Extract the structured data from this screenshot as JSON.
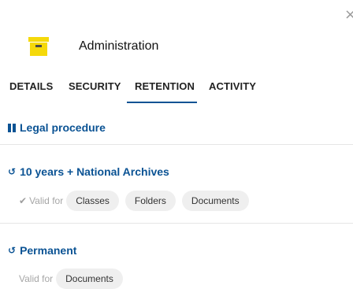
{
  "window": {
    "close_glyph": "×"
  },
  "header": {
    "title": "Administration",
    "icon": "box-icon",
    "icon_color": "#f5d90a"
  },
  "tabs": [
    {
      "label": "DETAILS"
    },
    {
      "label": "SECURITY"
    },
    {
      "label": "RETENTION",
      "active": true
    },
    {
      "label": "ACTIVITY"
    }
  ],
  "accent_color": "#0b5394",
  "group": {
    "title": "Legal procedure",
    "icon": "pause-icon"
  },
  "rules": [
    {
      "title": "10 years + National Archives",
      "icon": "history-icon",
      "valid_label": "Valid for",
      "valid_icon": "check-icon",
      "chips": [
        "Classes",
        "Folders",
        "Documents"
      ]
    },
    {
      "title": "Permanent",
      "icon": "history-icon",
      "valid_label": "Valid for",
      "chips": [
        "Documents"
      ]
    }
  ]
}
